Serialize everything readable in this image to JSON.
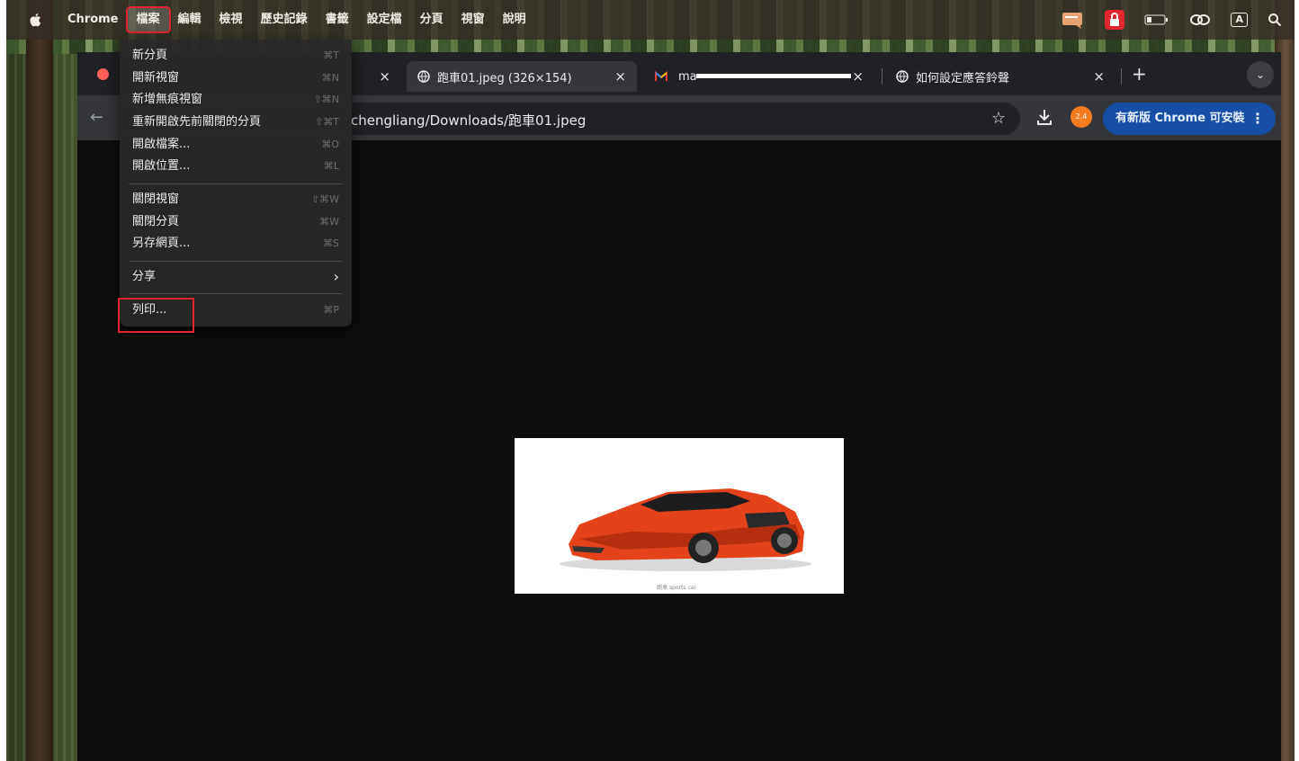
{
  "menubar": {
    "app_name": "Chrome",
    "items": [
      "檔案",
      "編輯",
      "檢視",
      "歷史記錄",
      "書籤",
      "設定檔",
      "分頁",
      "視窗",
      "說明"
    ],
    "active_index": 0
  },
  "status_icons": [
    "notes-icon",
    "lock-icon",
    "battery-icon",
    "link-icon",
    "input-method-icon",
    "search-icon"
  ],
  "status_input_label": "A",
  "file_menu": {
    "items": [
      {
        "label": "新分頁",
        "shortcut": "⌘T"
      },
      {
        "label": "開新視窗",
        "shortcut": "⌘N"
      },
      {
        "label": "新增無痕視窗",
        "shortcut": "⇧⌘N"
      },
      {
        "label": "重新開啟先前關閉的分頁",
        "shortcut": "⇧⌘T"
      },
      {
        "label": "開啟檔案...",
        "shortcut": "⌘O"
      },
      {
        "label": "開啟位置...",
        "shortcut": "⌘L"
      },
      {
        "label": "關閉視窗",
        "shortcut": "⇧⌘W"
      },
      {
        "label": "關閉分頁",
        "shortcut": "⌘W"
      },
      {
        "label": "另存網頁...",
        "shortcut": "⌘S"
      },
      {
        "label": "分享",
        "shortcut": "›"
      },
      {
        "label": "列印...",
        "shortcut": "⌘P"
      }
    ]
  },
  "tabs": [
    {
      "title": "",
      "close": "×"
    },
    {
      "title": "跑車01.jpeg (326×154)",
      "close": "×"
    },
    {
      "title": "ma",
      "close": "×"
    },
    {
      "title": "如何設定應答鈴聲",
      "close": "×"
    }
  ],
  "new_tab": "+",
  "tab_menu": "⌄",
  "address": {
    "url": "chengliang/Downloads/跑車01.jpeg",
    "bookmark": "☆"
  },
  "profile_badge": "2.4",
  "update_button": {
    "label": "有新版 Chrome 可安裝",
    "more": "⋮"
  },
  "image_caption": "跑車 sports car",
  "colors": {
    "highlight": "#e0262f",
    "update_bg": "#174ea6",
    "car": "#e3421a"
  }
}
